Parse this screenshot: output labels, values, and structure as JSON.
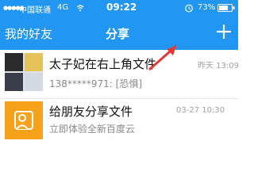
{
  "status_bar": {
    "carrier": "中国联通",
    "network": "4G",
    "time": "09:22",
    "battery": "73%"
  },
  "nav": {
    "left_label": "我的好友",
    "title": "分享"
  },
  "items": [
    {
      "title": "太子妃在右上角文件",
      "subtitle": "138*****971: [恐惧]",
      "time": "昨天 13:09"
    },
    {
      "title": "给朋友分享文件",
      "subtitle": "立即体验全新百度云",
      "time": "03-27 10:30"
    }
  ],
  "colors": {
    "header": "#2196f3",
    "share_icon_bg": "#f6a11a",
    "annotation_arrow": "#e53935"
  },
  "icons": {
    "add": "plus-icon",
    "share": "share-icon",
    "alarm": "alarm-icon",
    "battery": "battery-icon",
    "wifi": "wifi-icon"
  }
}
